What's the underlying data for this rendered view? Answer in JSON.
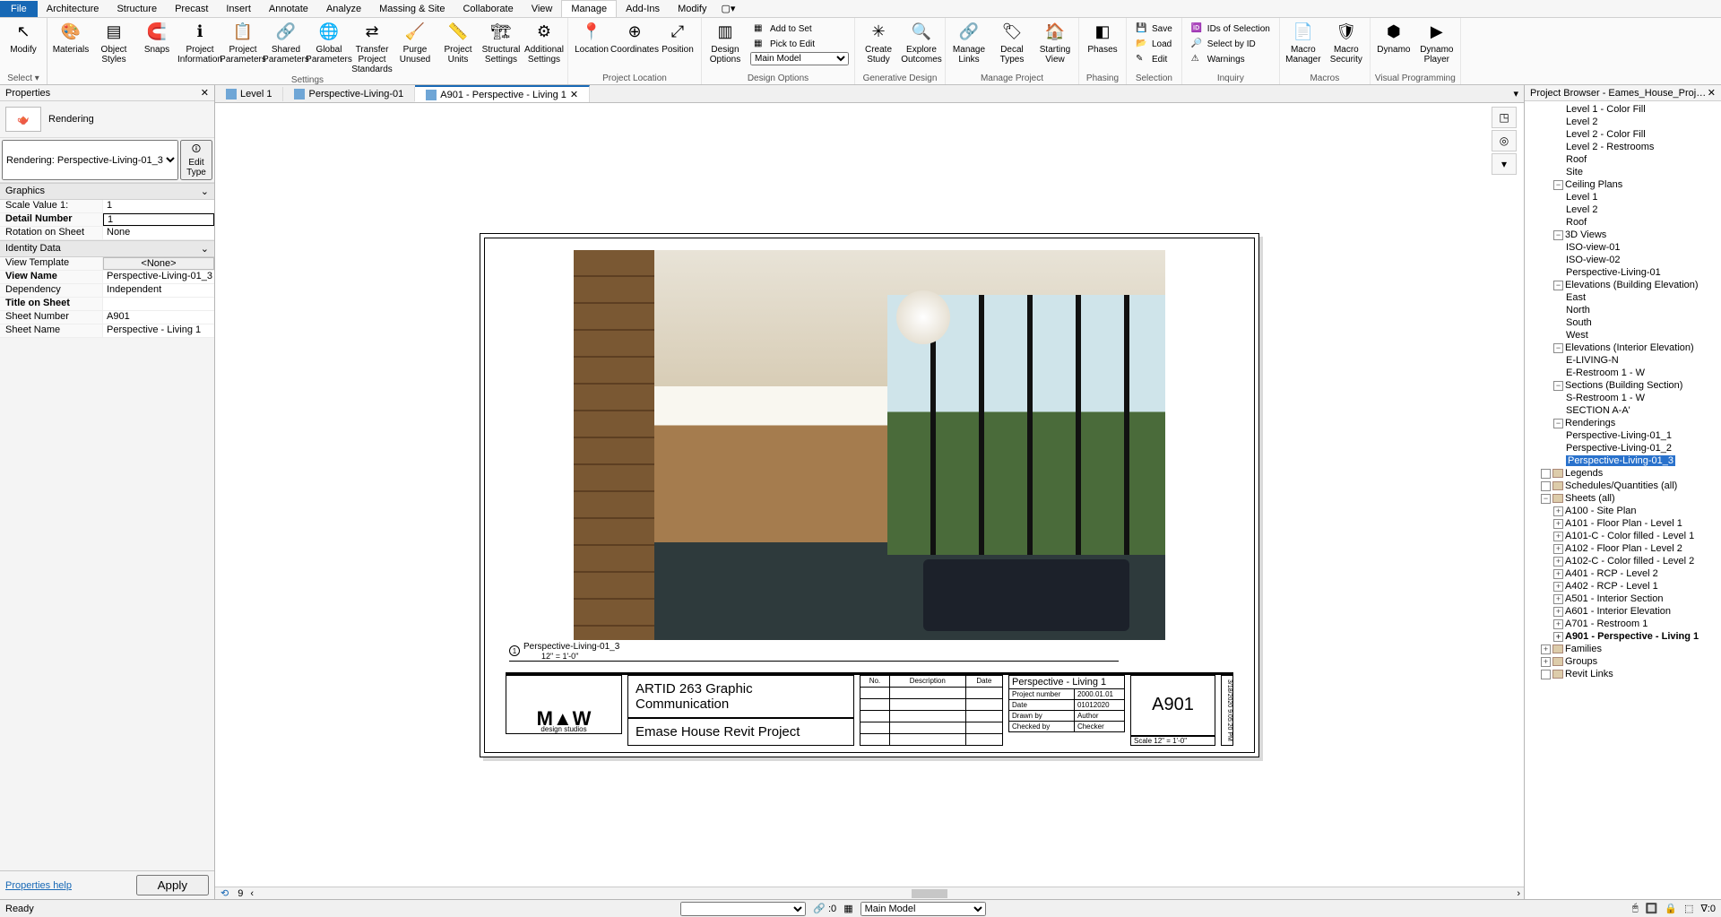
{
  "ribbon_tabs": {
    "file": "File",
    "items": [
      "Architecture",
      "Structure",
      "Precast",
      "Insert",
      "Annotate",
      "Analyze",
      "Massing & Site",
      "Collaborate",
      "View",
      "Manage",
      "Add-Ins",
      "Modify"
    ],
    "active": "Manage"
  },
  "ribbon": {
    "modify": "Modify",
    "select": "Select ▾",
    "settings_group": "Settings",
    "settings": [
      "Materials",
      "Object\nStyles",
      "Snaps",
      "Project\nInformation",
      "Project\nParameters",
      "Shared\nParameters",
      "Global\nParameters",
      "Transfer\nProject Standards",
      "Purge\nUnused",
      "Project\nUnits",
      "Structural\nSettings",
      "Additional\nSettings"
    ],
    "location_group": "Project Location",
    "location": [
      "Location",
      "Coordinates",
      "Position"
    ],
    "design_group": "Design Options",
    "design": "Design\nOptions",
    "design_small": [
      "Add to Set",
      "Pick to Edit"
    ],
    "design_combo": "Main Model",
    "gendesign_group": "Generative Design",
    "gendesign": [
      "Create\nStudy",
      "Explore\nOutcomes"
    ],
    "manageproj_group": "Manage Project",
    "manageproj": [
      "Manage\nLinks",
      "Decal\nTypes",
      "Starting\nView"
    ],
    "phasing_group": "Phasing",
    "phasing": "Phases",
    "selection_group": "Selection",
    "selection_small": [
      "Save",
      "Load",
      "Edit"
    ],
    "selection_small2": [
      "IDs of Selection",
      "Select by ID",
      "Warnings"
    ],
    "inquiry_group": "Inquiry",
    "macros_group": "Macros",
    "macros": [
      "Macro\nManager",
      "Macro\nSecurity"
    ],
    "vprog_group": "Visual Programming",
    "vprog": [
      "Dynamo",
      "Dynamo\nPlayer"
    ]
  },
  "view_tabs": [
    {
      "label": "Level 1",
      "active": false
    },
    {
      "label": "Perspective-Living-01",
      "active": false
    },
    {
      "label": "A901 - Perspective - Living 1",
      "active": true
    }
  ],
  "properties": {
    "panel_title": "Properties",
    "type_name": "Rendering",
    "instance_sel": "Rendering: Perspective-Living-01_3",
    "edit_type": "Edit Type",
    "sections": {
      "graphics": "Graphics",
      "identity": "Identity Data"
    },
    "rows": {
      "scale_value_k": "Scale Value    1:",
      "scale_value_v": "1",
      "detail_number_k": "Detail Number",
      "detail_number_v": "1",
      "rotation_k": "Rotation on Sheet",
      "rotation_v": "None",
      "view_template_k": "View Template",
      "view_template_v": "<None>",
      "view_name_k": "View Name",
      "view_name_v": "Perspective-Living-01_3",
      "dependency_k": "Dependency",
      "dependency_v": "Independent",
      "title_on_sheet_k": "Title on Sheet",
      "title_on_sheet_v": "",
      "sheet_number_k": "Sheet Number",
      "sheet_number_v": "A901",
      "sheet_name_k": "Sheet Name",
      "sheet_name_v": "Perspective - Living 1"
    },
    "help": "Properties help",
    "apply": "Apply"
  },
  "sheet": {
    "viewport_name": "Perspective-Living-01_3",
    "viewport_scale": "12\" = 1'-0\"",
    "viewport_num": "1",
    "title_line1": "ARTID 263 Graphic Communication",
    "title_line2": "Emase House Revit Project",
    "rev_headers": [
      "No.",
      "Description",
      "Date"
    ],
    "info": {
      "sheet_title": "Perspective - Living 1",
      "project_num_k": "Project number",
      "project_num_v": "2000.01.01",
      "date_k": "Date",
      "date_v": "01012020",
      "drawn_k": "Drawn by",
      "drawn_v": "Author",
      "checked_k": "Checked by",
      "checked_v": "Checker",
      "scale_k": "Scale",
      "scale_v": "12\" = 1'-0\""
    },
    "sheet_num": "A901",
    "logo_text": "design  studios",
    "print_date": "3/18/2020 9:05:20 PM"
  },
  "browser": {
    "title": "Project Browser - Eames_House_Project_Yongye...",
    "tree": [
      {
        "ind": 3,
        "label": "Level 1 - Color Fill"
      },
      {
        "ind": 3,
        "label": "Level 2"
      },
      {
        "ind": 3,
        "label": "Level 2 - Color Fill"
      },
      {
        "ind": 3,
        "label": "Level 2 - Restrooms"
      },
      {
        "ind": 3,
        "label": "Roof"
      },
      {
        "ind": 3,
        "label": "Site"
      },
      {
        "ind": 2,
        "exp": "-",
        "label": "Ceiling Plans"
      },
      {
        "ind": 3,
        "label": "Level 1"
      },
      {
        "ind": 3,
        "label": "Level 2"
      },
      {
        "ind": 3,
        "label": "Roof"
      },
      {
        "ind": 2,
        "exp": "-",
        "label": "3D Views"
      },
      {
        "ind": 3,
        "label": "ISO-view-01"
      },
      {
        "ind": 3,
        "label": "ISO-view-02"
      },
      {
        "ind": 3,
        "label": "Perspective-Living-01"
      },
      {
        "ind": 2,
        "exp": "-",
        "label": "Elevations (Building Elevation)"
      },
      {
        "ind": 3,
        "label": "East"
      },
      {
        "ind": 3,
        "label": "North"
      },
      {
        "ind": 3,
        "label": "South"
      },
      {
        "ind": 3,
        "label": "West"
      },
      {
        "ind": 2,
        "exp": "-",
        "label": "Elevations (Interior Elevation)"
      },
      {
        "ind": 3,
        "label": "E-LIVING-N"
      },
      {
        "ind": 3,
        "label": "E-Restroom 1 - W"
      },
      {
        "ind": 2,
        "exp": "-",
        "label": "Sections (Building Section)"
      },
      {
        "ind": 3,
        "label": "S-Restroom 1 - W"
      },
      {
        "ind": 3,
        "label": "SECTION A-A'"
      },
      {
        "ind": 2,
        "exp": "-",
        "label": "Renderings"
      },
      {
        "ind": 3,
        "label": "Perspective-Living-01_1"
      },
      {
        "ind": 3,
        "label": "Perspective-Living-01_2"
      },
      {
        "ind": 3,
        "label": "Perspective-Living-01_3",
        "sel": true
      },
      {
        "ind": 1,
        "exp": " ",
        "ico": true,
        "label": "Legends"
      },
      {
        "ind": 1,
        "exp": " ",
        "ico": true,
        "label": "Schedules/Quantities (all)"
      },
      {
        "ind": 1,
        "exp": "-",
        "ico": true,
        "label": "Sheets (all)"
      },
      {
        "ind": 2,
        "exp": "+",
        "label": "A100 - Site Plan"
      },
      {
        "ind": 2,
        "exp": "+",
        "label": "A101 - Floor Plan - Level 1"
      },
      {
        "ind": 2,
        "exp": "+",
        "label": "A101-C - Color filled - Level 1"
      },
      {
        "ind": 2,
        "exp": "+",
        "label": "A102 - Floor Plan - Level 2"
      },
      {
        "ind": 2,
        "exp": "+",
        "label": "A102-C - Color filled - Level 2"
      },
      {
        "ind": 2,
        "exp": "+",
        "label": "A401 - RCP - Level 2"
      },
      {
        "ind": 2,
        "exp": "+",
        "label": "A402 - RCP - Level 1"
      },
      {
        "ind": 2,
        "exp": "+",
        "label": "A501 - Interior Section"
      },
      {
        "ind": 2,
        "exp": "+",
        "label": "A601 - Interior Elevation"
      },
      {
        "ind": 2,
        "exp": "+",
        "label": "A701 - Restroom 1"
      },
      {
        "ind": 2,
        "exp": "+",
        "label": "A901 - Perspective - Living 1",
        "bold": true
      },
      {
        "ind": 1,
        "exp": "+",
        "ico": true,
        "label": "Families"
      },
      {
        "ind": 1,
        "exp": "+",
        "ico": true,
        "label": "Groups"
      },
      {
        "ind": 1,
        "exp": " ",
        "ico": true,
        "label": "Revit Links"
      }
    ]
  },
  "status": {
    "ready": "Ready",
    "main_model": "Main Model",
    "zero": ":0"
  }
}
